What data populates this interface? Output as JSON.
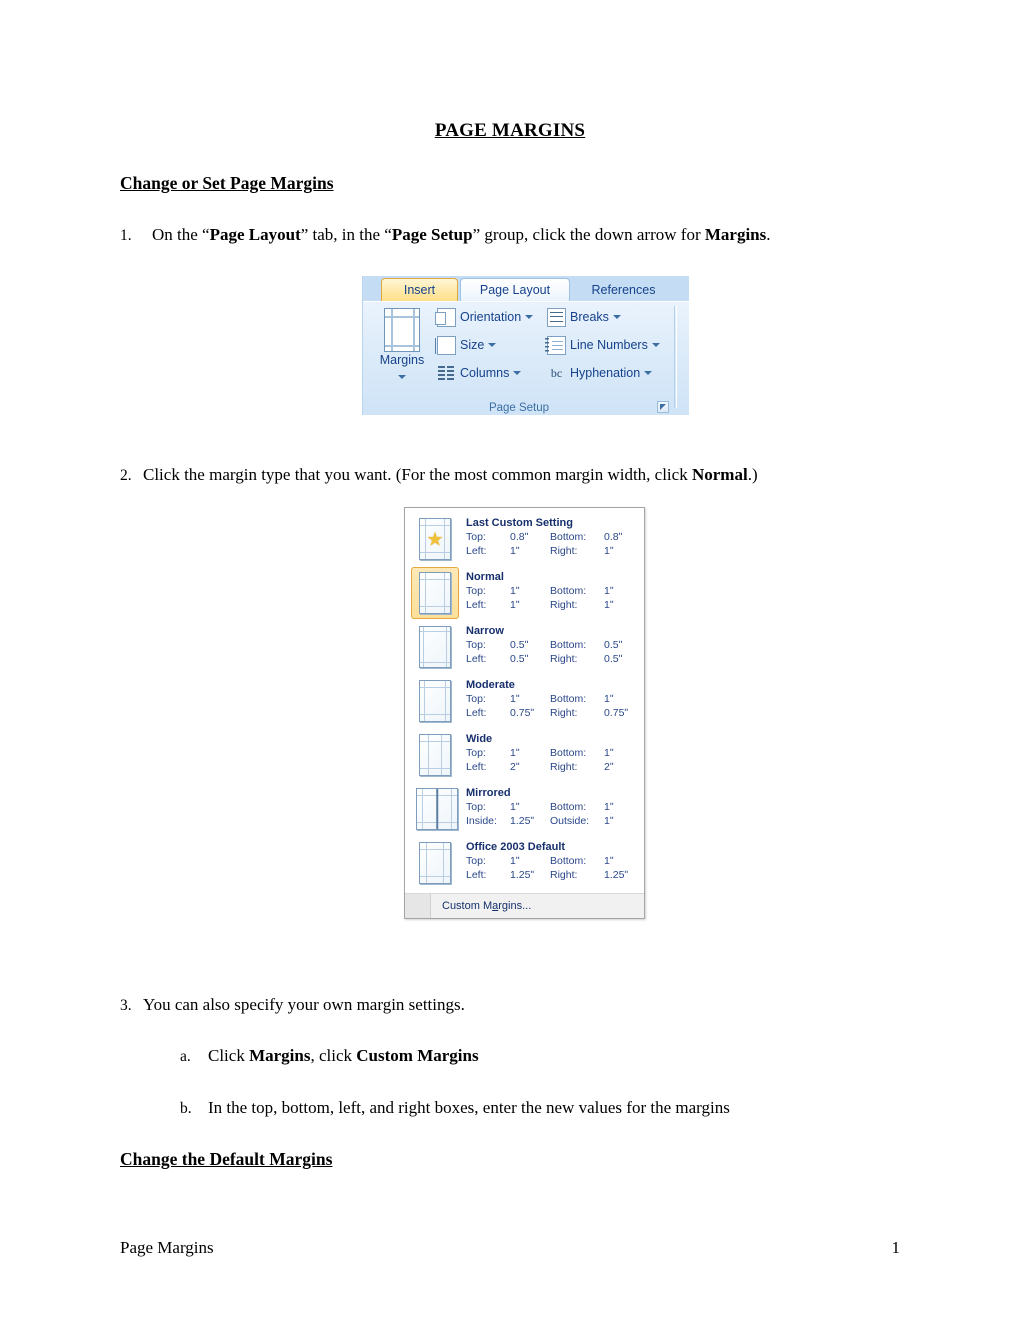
{
  "document": {
    "title": "PAGE MARGINS",
    "headings": {
      "change_or_set": "Change or Set Page Margins",
      "change_default": "Change the Default Margins"
    },
    "steps": [
      {
        "number": "1.",
        "text_parts": [
          "On the “",
          "Page Layout",
          "” tab, in the “",
          "Page Setup",
          "” group, click the down arrow for ",
          "Margins",
          "."
        ]
      },
      {
        "number": "2.",
        "text_parts": [
          "Click the margin type that you want.  (For the most common margin width, click ",
          "Normal",
          ".)"
        ]
      },
      {
        "number": "3.",
        "text_parts": [
          "You can also specify your own margin settings."
        ]
      }
    ],
    "substeps": [
      {
        "number": "a.",
        "text_parts": [
          "Click ",
          "Margins",
          ", click ",
          "Custom Margins",
          ""
        ]
      },
      {
        "number": "b.",
        "text_parts": [
          "In the top, bottom, left, and right boxes, enter the new values for the margins"
        ]
      }
    ],
    "footer": {
      "left": "Page Margins",
      "right": "1"
    }
  },
  "ribbon_screenshot": {
    "tabs": [
      {
        "label": "Insert",
        "state": "highlighted"
      },
      {
        "label": "Page Layout",
        "state": "active"
      },
      {
        "label": "References",
        "state": "normal"
      }
    ],
    "group_label": "Page Setup",
    "big_button": {
      "label": "Margins",
      "icon": "page-margins-icon",
      "has_dropdown": true
    },
    "commands_left": [
      {
        "label": "Orientation",
        "icon": "orientation-icon",
        "has_dropdown": true
      },
      {
        "label": "Size",
        "icon": "page-size-icon",
        "has_dropdown": true
      },
      {
        "label": "Columns",
        "icon": "columns-icon",
        "has_dropdown": true
      }
    ],
    "commands_right": [
      {
        "label": "Breaks",
        "icon": "breaks-icon",
        "has_dropdown": true
      },
      {
        "label": "Line Numbers",
        "icon": "line-numbers-icon",
        "has_dropdown": true
      },
      {
        "label": "Hyphenation",
        "icon": "hyphenation-icon",
        "has_dropdown": true,
        "glyph": "bc"
      }
    ],
    "dialog_launcher": "dialog-box-launcher-icon",
    "colors": {
      "tab_active_bg": "#f4f9fe",
      "tab_highlight_bg": "#ffe9a8",
      "ribbon_bg": "#dcebf9",
      "text_blue": "#15428b"
    }
  },
  "margins_menu": {
    "labels": {
      "top": "Top:",
      "bottom": "Bottom:",
      "left": "Left:",
      "right": "Right:",
      "inside": "Inside:",
      "outside": "Outside:"
    },
    "items": [
      {
        "name": "Last Custom Setting",
        "icon": "page-thumbnail-star-icon",
        "selected": false,
        "l1": "Top:",
        "v1": "0.8ʺ",
        "l2": "Bottom:",
        "v2": "0.8ʺ",
        "l3": "Left:",
        "v3": "1ʺ",
        "l4": "Right:",
        "v4": "1ʺ"
      },
      {
        "name": "Normal",
        "icon": "page-thumbnail-icon",
        "selected": true,
        "l1": "Top:",
        "v1": "1ʺ",
        "l2": "Bottom:",
        "v2": "1ʺ",
        "l3": "Left:",
        "v3": "1ʺ",
        "l4": "Right:",
        "v4": "1ʺ"
      },
      {
        "name": "Narrow",
        "icon": "page-thumbnail-icon",
        "selected": false,
        "l1": "Top:",
        "v1": "0.5ʺ",
        "l2": "Bottom:",
        "v2": "0.5ʺ",
        "l3": "Left:",
        "v3": "0.5ʺ",
        "l4": "Right:",
        "v4": "0.5ʺ"
      },
      {
        "name": "Moderate",
        "icon": "page-thumbnail-icon",
        "selected": false,
        "l1": "Top:",
        "v1": "1ʺ",
        "l2": "Bottom:",
        "v2": "1ʺ",
        "l3": "Left:",
        "v3": "0.75ʺ",
        "l4": "Right:",
        "v4": "0.75ʺ"
      },
      {
        "name": "Wide",
        "icon": "page-thumbnail-icon",
        "selected": false,
        "l1": "Top:",
        "v1": "1ʺ",
        "l2": "Bottom:",
        "v2": "1ʺ",
        "l3": "Left:",
        "v3": "2ʺ",
        "l4": "Right:",
        "v4": "2ʺ"
      },
      {
        "name": "Mirrored",
        "icon": "page-thumbnail-mirrored-icon",
        "selected": false,
        "l1": "Top:",
        "v1": "1ʺ",
        "l2": "Bottom:",
        "v2": "1ʺ",
        "l3": "Inside:",
        "v3": "1.25ʺ",
        "l4": "Outside:",
        "v4": "1ʺ"
      },
      {
        "name": "Office 2003 Default",
        "icon": "page-thumbnail-icon",
        "selected": false,
        "l1": "Top:",
        "v1": "1ʺ",
        "l2": "Bottom:",
        "v2": "1ʺ",
        "l3": "Left:",
        "v3": "1.25ʺ",
        "l4": "Right:",
        "v4": "1.25ʺ"
      }
    ],
    "custom_margins": {
      "pre": "Custom M",
      "accel": "a",
      "post": "rgins..."
    },
    "colors": {
      "selected_bg": "#fcdf9a",
      "selected_border": "#e3a93c",
      "text": "#17306d"
    }
  }
}
